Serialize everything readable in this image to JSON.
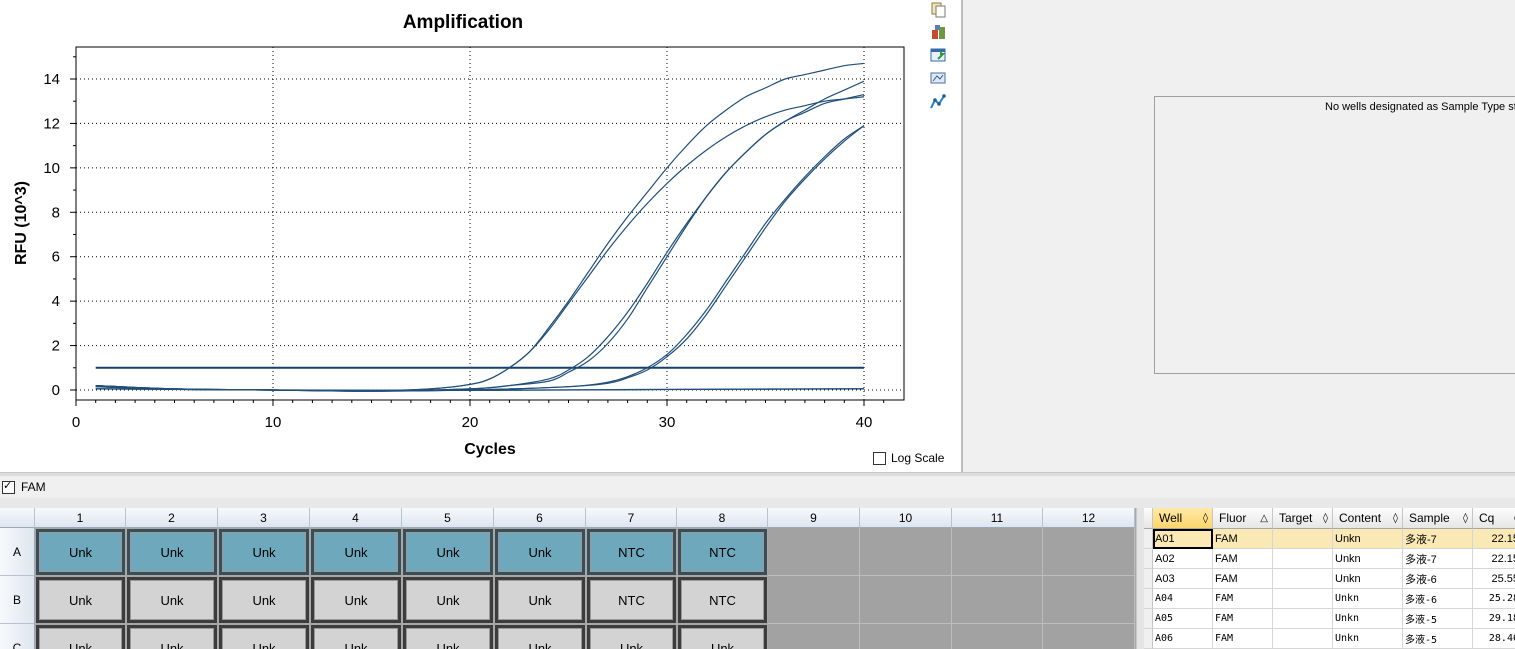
{
  "chart_data": {
    "type": "line",
    "title": "Amplification",
    "xlabel": "Cycles",
    "ylabel": "RFU (10^3)",
    "xlim": [
      0,
      42
    ],
    "ylim": [
      -0.5,
      15.5
    ],
    "xticks": [
      0,
      10,
      20,
      30,
      40
    ],
    "yticks": [
      0,
      2,
      4,
      6,
      8,
      10,
      12,
      14
    ],
    "grid": true,
    "threshold": 1.0,
    "series": [
      {
        "values": [
          [
            1,
            0.2
          ],
          [
            5,
            0.05
          ],
          [
            10,
            0.0
          ],
          [
            15,
            -0.03
          ],
          [
            18,
            0.05
          ],
          [
            20,
            0.25
          ],
          [
            21,
            0.5
          ],
          [
            22,
            1.0
          ],
          [
            23,
            1.7
          ],
          [
            24,
            2.8
          ],
          [
            25,
            4.0
          ],
          [
            26,
            5.3
          ],
          [
            27,
            6.6
          ],
          [
            28,
            7.8
          ],
          [
            29,
            8.9
          ],
          [
            30,
            10.0
          ],
          [
            31,
            11.0
          ],
          [
            32,
            11.9
          ],
          [
            33,
            12.6
          ],
          [
            34,
            13.2
          ],
          [
            35,
            13.6
          ],
          [
            36,
            14.0
          ],
          [
            37,
            14.2
          ],
          [
            38,
            14.4
          ],
          [
            39,
            14.6
          ],
          [
            40,
            14.7
          ]
        ]
      },
      {
        "values": [
          [
            1,
            0.2
          ],
          [
            5,
            0.05
          ],
          [
            10,
            0.0
          ],
          [
            15,
            -0.03
          ],
          [
            18,
            0.05
          ],
          [
            20,
            0.25
          ],
          [
            21,
            0.5
          ],
          [
            22,
            1.0
          ],
          [
            23,
            1.7
          ],
          [
            24,
            2.7
          ],
          [
            25,
            3.9
          ],
          [
            26,
            5.1
          ],
          [
            27,
            6.3
          ],
          [
            28,
            7.4
          ],
          [
            29,
            8.4
          ],
          [
            30,
            9.3
          ],
          [
            31,
            10.1
          ],
          [
            32,
            10.8
          ],
          [
            33,
            11.4
          ],
          [
            34,
            11.9
          ],
          [
            35,
            12.3
          ],
          [
            36,
            12.6
          ],
          [
            37,
            12.8
          ],
          [
            38,
            13.0
          ],
          [
            39,
            13.1
          ],
          [
            40,
            13.2
          ]
        ]
      },
      {
        "values": [
          [
            1,
            0.2
          ],
          [
            5,
            0.05
          ],
          [
            10,
            0.0
          ],
          [
            15,
            -0.05
          ],
          [
            20,
            0.05
          ],
          [
            22,
            0.2
          ],
          [
            24,
            0.5
          ],
          [
            25,
            0.9
          ],
          [
            26,
            1.5
          ],
          [
            27,
            2.4
          ],
          [
            28,
            3.5
          ],
          [
            29,
            4.8
          ],
          [
            30,
            6.2
          ],
          [
            31,
            7.5
          ],
          [
            32,
            8.7
          ],
          [
            33,
            9.8
          ],
          [
            34,
            10.7
          ],
          [
            35,
            11.5
          ],
          [
            36,
            12.1
          ],
          [
            37,
            12.6
          ],
          [
            38,
            13.1
          ],
          [
            39,
            13.5
          ],
          [
            40,
            13.9
          ]
        ]
      },
      {
        "values": [
          [
            1,
            0.2
          ],
          [
            5,
            0.05
          ],
          [
            10,
            0.0
          ],
          [
            15,
            -0.05
          ],
          [
            20,
            0.05
          ],
          [
            22,
            0.2
          ],
          [
            24,
            0.4
          ],
          [
            25,
            0.8
          ],
          [
            26,
            1.3
          ],
          [
            27,
            2.1
          ],
          [
            28,
            3.2
          ],
          [
            29,
            4.6
          ],
          [
            30,
            6.0
          ],
          [
            31,
            7.4
          ],
          [
            32,
            8.7
          ],
          [
            33,
            9.8
          ],
          [
            34,
            10.7
          ],
          [
            35,
            11.5
          ],
          [
            36,
            12.1
          ],
          [
            37,
            12.5
          ],
          [
            38,
            12.9
          ],
          [
            39,
            13.1
          ],
          [
            40,
            13.3
          ]
        ]
      },
      {
        "values": [
          [
            1,
            0.15
          ],
          [
            5,
            0.03
          ],
          [
            10,
            0.0
          ],
          [
            15,
            -0.05
          ],
          [
            20,
            0.0
          ],
          [
            25,
            0.15
          ],
          [
            27,
            0.35
          ],
          [
            28,
            0.6
          ],
          [
            29,
            1.0
          ],
          [
            30,
            1.6
          ],
          [
            31,
            2.5
          ],
          [
            32,
            3.6
          ],
          [
            33,
            4.9
          ],
          [
            34,
            6.2
          ],
          [
            35,
            7.5
          ],
          [
            36,
            8.6
          ],
          [
            37,
            9.6
          ],
          [
            38,
            10.5
          ],
          [
            39,
            11.3
          ],
          [
            40,
            11.9
          ]
        ]
      },
      {
        "values": [
          [
            1,
            0.15
          ],
          [
            5,
            0.03
          ],
          [
            10,
            0.0
          ],
          [
            15,
            -0.05
          ],
          [
            20,
            0.0
          ],
          [
            25,
            0.15
          ],
          [
            27,
            0.3
          ],
          [
            28,
            0.55
          ],
          [
            29,
            0.9
          ],
          [
            30,
            1.5
          ],
          [
            31,
            2.3
          ],
          [
            32,
            3.4
          ],
          [
            33,
            4.7
          ],
          [
            34,
            6.0
          ],
          [
            35,
            7.3
          ],
          [
            36,
            8.5
          ],
          [
            37,
            9.5
          ],
          [
            38,
            10.4
          ],
          [
            39,
            11.2
          ],
          [
            40,
            11.9
          ]
        ]
      },
      {
        "values": [
          [
            1,
            0.05
          ],
          [
            10,
            0.0
          ],
          [
            20,
            -0.02
          ],
          [
            30,
            0.02
          ],
          [
            40,
            0.05
          ]
        ]
      },
      {
        "values": [
          [
            1,
            0.06
          ],
          [
            10,
            0.0
          ],
          [
            20,
            -0.01
          ],
          [
            30,
            0.03
          ],
          [
            40,
            0.06
          ]
        ]
      }
    ]
  },
  "log_scale_label": "Log Scale",
  "log_scale_checked": false,
  "toolbar_icons": [
    "copy-icon",
    "export-icon",
    "save-image-icon",
    "print-icon",
    "chart-settings-icon"
  ],
  "std_curve_message": "No wells designated as Sample Type stan",
  "fluor_label": "FAM",
  "fluor_checked": true,
  "plate": {
    "columns": [
      "1",
      "2",
      "3",
      "4",
      "5",
      "6",
      "7",
      "8",
      "9",
      "10",
      "11",
      "12"
    ],
    "rows": [
      {
        "label": "A",
        "wells": [
          "Unk",
          "Unk",
          "Unk",
          "Unk",
          "Unk",
          "Unk",
          "NTC",
          "NTC"
        ],
        "selected": true
      },
      {
        "label": "B",
        "wells": [
          "Unk",
          "Unk",
          "Unk",
          "Unk",
          "Unk",
          "Unk",
          "NTC",
          "NTC"
        ],
        "selected": false
      },
      {
        "label": "C",
        "wells": [
          "Unk",
          "Unk",
          "Unk",
          "Unk",
          "Unk",
          "Unk",
          "Unk",
          "Unk"
        ],
        "selected": false
      }
    ]
  },
  "table": {
    "columns": [
      {
        "label": "Well",
        "sort": "◊",
        "active": true
      },
      {
        "label": "Fluor",
        "sort": "△",
        "active": false
      },
      {
        "label": "Target",
        "sort": "◊",
        "active": false
      },
      {
        "label": "Content",
        "sort": "◊",
        "active": false
      },
      {
        "label": "Sample",
        "sort": "◊",
        "active": false
      },
      {
        "label": "Cq",
        "sort": "◊",
        "active": false
      }
    ],
    "rows": [
      [
        "A01",
        "FAM",
        "",
        "Unkn",
        "多液-7",
        "22.15"
      ],
      [
        "A02",
        "FAM",
        "",
        "Unkn",
        "多液-7",
        "22.15"
      ],
      [
        "A03",
        "FAM",
        "",
        "Unkn",
        "多液-6",
        "25.55"
      ],
      [
        "A04",
        "FAM",
        "",
        "Unkn",
        "多液-6",
        "25.28"
      ],
      [
        "A05",
        "FAM",
        "",
        "Unkn",
        "多液-5",
        "29.18"
      ],
      [
        "A06",
        "FAM",
        "",
        "Unkn",
        "多液-5",
        "28.46"
      ]
    ]
  },
  "colors": {
    "curve": "#1f4e79",
    "threshold": "#143f6e",
    "well_selected": "#6ea8bd",
    "well_unselected": "#d3d3d3",
    "empty_well": "#a2a2a2"
  }
}
